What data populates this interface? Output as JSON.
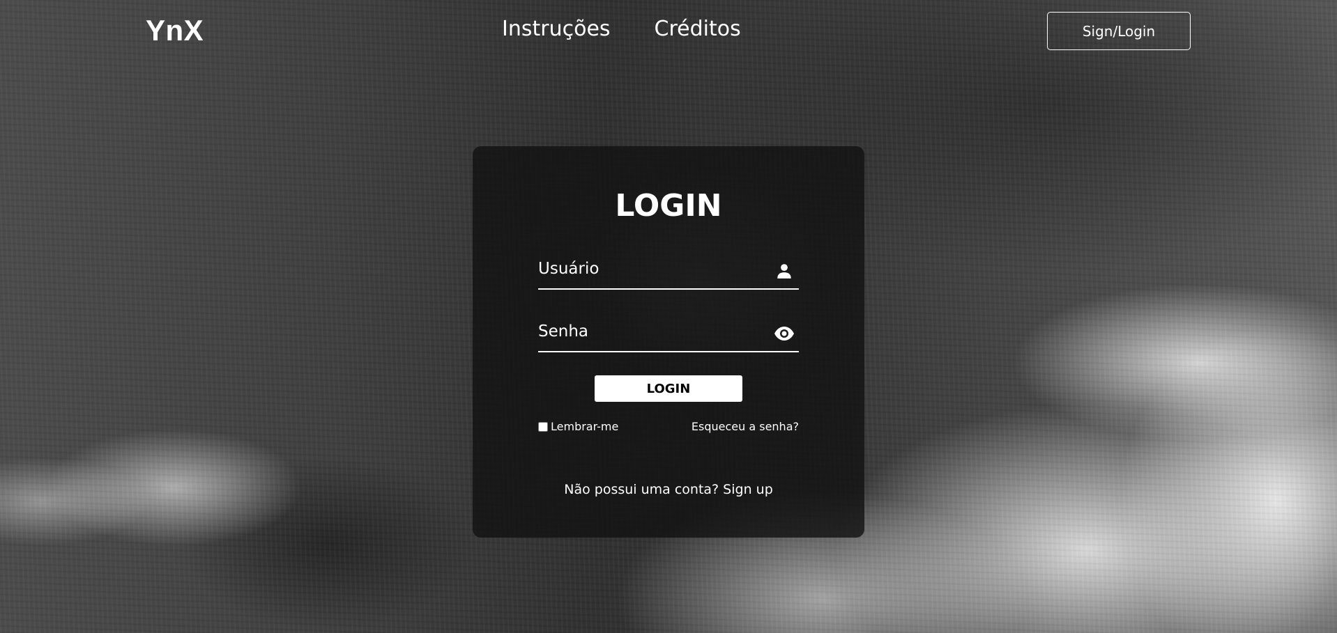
{
  "header": {
    "logo": "YnX",
    "nav": [
      "Instruções",
      "Créditos"
    ],
    "auth_button": "Sign/Login"
  },
  "login": {
    "title": "LOGIN",
    "username_placeholder": "Usuário",
    "username_icon": "user-icon",
    "password_placeholder": "Senha",
    "password_icon": "eye-icon",
    "submit_label": "LOGIN",
    "remember_label": "Lembrar-me",
    "remember_checked": false,
    "forgot_label": "Esqueceu a senha?",
    "no_account_text": "Não possui uma conta?",
    "signup_label": "Sign up"
  },
  "colors": {
    "text": "#ffffff",
    "card_background": "rgba(18,18,18,0.80)",
    "button_background": "#ffffff",
    "button_text": "#000000"
  }
}
